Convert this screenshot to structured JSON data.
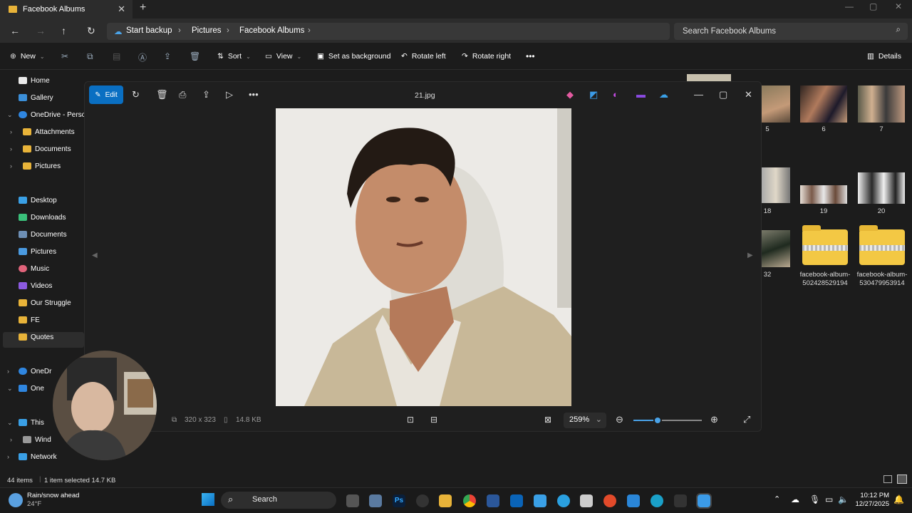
{
  "explorer": {
    "tab_title": "Facebook Albums",
    "breadcrumbs": [
      "Start backup",
      "Pictures",
      "Facebook Albums"
    ],
    "search_placeholder": "Search Facebook Albums",
    "commands": {
      "new": "New",
      "sort": "Sort",
      "view": "View",
      "set_background": "Set as background",
      "rotate_left": "Rotate left",
      "rotate_right": "Rotate right",
      "details": "Details"
    },
    "sidebar": {
      "home": "Home",
      "gallery": "Gallery",
      "onedrive_personal": "OneDrive - Personal",
      "attachments": "Attachments",
      "documents_od": "Documents",
      "pictures_od": "Pictures",
      "desktop": "Desktop",
      "downloads": "Downloads",
      "documents": "Documents",
      "pictures": "Pictures",
      "music": "Music",
      "videos": "Videos",
      "our_struggle": "Our Struggle",
      "fe": "FE",
      "quotes": "Quotes",
      "onedrive2": "OneDr",
      "one": "One",
      "this_pc": "This",
      "windows": "Wind",
      "network": "Network"
    },
    "files": {
      "row1": [
        "5",
        "6",
        "7"
      ],
      "row2": [
        "18",
        "19",
        "20"
      ],
      "row3_thumb": "32",
      "zip1": "facebook-album-502428529194",
      "zip2": "facebook-album-530479953914"
    },
    "status": {
      "item_count": "44 items",
      "selection": "1 item selected  14.7 KB"
    }
  },
  "viewer": {
    "edit_label": "Edit",
    "file_name": "21.jpg",
    "dimensions": "320 x 323",
    "file_size": "14.8 KB",
    "zoom": "259%",
    "zoom_level": 0.35
  },
  "taskbar": {
    "weather_title": "Rain/snow ahead",
    "weather_temp": "24°F",
    "search_label": "Search",
    "time": "10:12 PM",
    "date": "12/27/2025"
  }
}
